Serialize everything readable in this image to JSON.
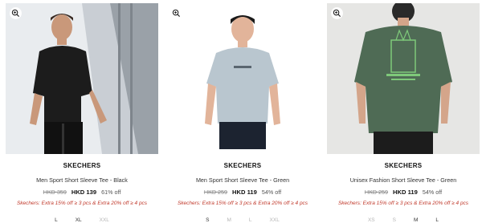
{
  "products": [
    {
      "brand": "SKECHERS",
      "name": "Men Sport Short Sleeve Tee - Black",
      "original_price": "HKD 359",
      "sale_price": "HKD 139",
      "discount": "61% off",
      "promo": "Skechers: Extra 15% off ≥ 3 pcs & Extra 20% off ≥ 4 pcs",
      "sizes": [
        {
          "label": "L",
          "available": true
        },
        {
          "label": "XL",
          "available": true
        },
        {
          "label": "XXL",
          "available": false
        }
      ]
    },
    {
      "brand": "SKECHERS",
      "name": "Men Sport Short Sleeve Tee - Green",
      "original_price": "HKD 259",
      "sale_price": "HKD 119",
      "discount": "54% off",
      "promo": "Skechers: Extra 15% off ≥ 3 pcs & Extra 20% off ≥ 4 pcs",
      "sizes": [
        {
          "label": "S",
          "available": true
        },
        {
          "label": "M",
          "available": false
        },
        {
          "label": "L",
          "available": false
        },
        {
          "label": "XXL",
          "available": false
        }
      ]
    },
    {
      "brand": "SKECHERS",
      "name": "Unisex Fashion Short Sleeve Tee - Green",
      "original_price": "HKD 259",
      "sale_price": "HKD 119",
      "discount": "54% off",
      "promo": "Skechers: Extra 15% off ≥ 3 pcs & Extra 20% off ≥ 4 pcs",
      "sizes": [
        {
          "label": "XS",
          "available": false
        },
        {
          "label": "S",
          "available": false
        },
        {
          "label": "M",
          "available": true
        },
        {
          "label": "L",
          "available": true
        }
      ]
    }
  ],
  "icons": {
    "zoom": "zoom-in-icon"
  },
  "colors": {
    "promo": "#c0392b",
    "tee_black": "#1c1c1c",
    "tee_grey": "#b9c6cf",
    "tee_green": "#4f6b55"
  }
}
